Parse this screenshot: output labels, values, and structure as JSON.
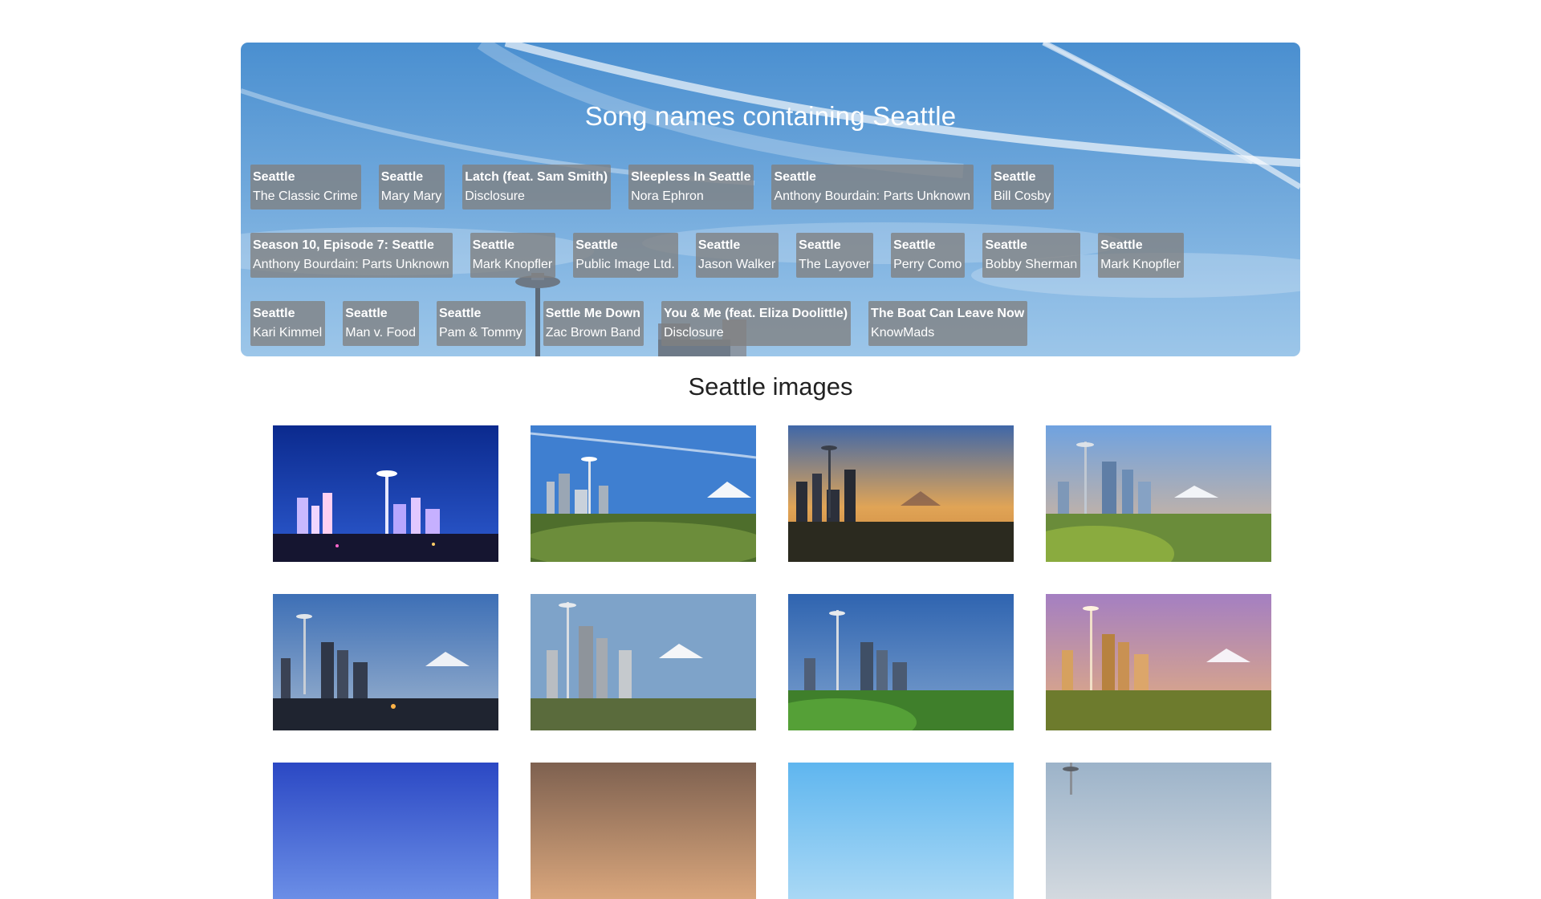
{
  "hero": {
    "title": "Song names containing Seattle",
    "songs": [
      [
        {
          "title": "Seattle",
          "artist": "The Classic Crime"
        },
        {
          "title": "Seattle",
          "artist": "Mary Mary"
        },
        {
          "title": "Latch (feat. Sam Smith)",
          "artist": "Disclosure"
        },
        {
          "title": "Sleepless In Seattle",
          "artist": "Nora Ephron"
        },
        {
          "title": "Seattle",
          "artist": "Anthony Bourdain: Parts Unknown"
        },
        {
          "title": "Seattle",
          "artist": "Bill Cosby"
        }
      ],
      [
        {
          "title": "Season 10, Episode 7: Seattle",
          "artist": "Anthony Bourdain: Parts Unknown"
        },
        {
          "title": "Seattle",
          "artist": "Mark Knopfler"
        },
        {
          "title": "Seattle",
          "artist": "Public Image Ltd."
        },
        {
          "title": "Seattle",
          "artist": "Jason Walker"
        },
        {
          "title": "Seattle",
          "artist": "The Layover"
        },
        {
          "title": "Seattle",
          "artist": "Perry Como"
        },
        {
          "title": "Seattle",
          "artist": "Bobby Sherman"
        },
        {
          "title": "Seattle",
          "artist": "Mark Knopfler"
        }
      ],
      [
        {
          "title": "Seattle",
          "artist": "Kari Kimmel"
        },
        {
          "title": "Seattle",
          "artist": "Man v. Food"
        },
        {
          "title": "Seattle",
          "artist": "Pam & Tommy"
        },
        {
          "title": "Settle Me Down",
          "artist": "Zac Brown Band"
        },
        {
          "title": "You & Me (feat. Eliza Doolittle)",
          "artist": "Disclosure"
        },
        {
          "title": "The Boat Can Leave Now",
          "artist": "KnowMads"
        }
      ]
    ]
  },
  "images_section": {
    "title": "Seattle images"
  }
}
